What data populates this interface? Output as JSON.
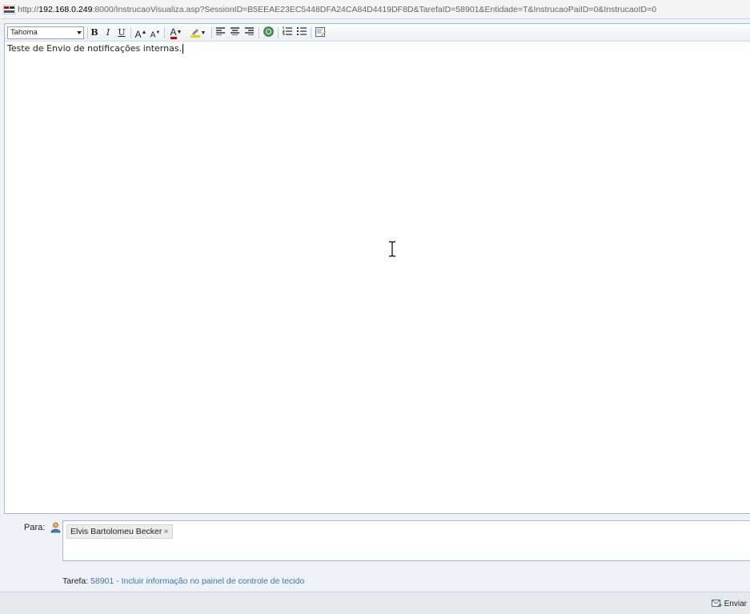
{
  "address_bar": {
    "url_prefix": "http://",
    "url_host": "192.168.0.249",
    "url_rest": ":8000/InstrucaoVisualiza.asp?SessionID=B5EEAE23EC5448DFA24CA84D4419DF8D&TarefaID=58901&Entidade=T&InstrucaoPaiID=0&InstrucaoID=0",
    "page_icon": "site-favicon-icon"
  },
  "toolbar": {
    "font_value": "Tahoma",
    "bold_label": "B",
    "italic_label": "I",
    "underline_label": "U",
    "grow_font_label": "A",
    "shrink_font_label": "A",
    "text_color_label": "A",
    "text_color": "#cc0000",
    "highlight_color": "#f0d000"
  },
  "editor": {
    "content": "Teste de Envio de notificações internas."
  },
  "recipients": {
    "label": "Para:",
    "items": [
      {
        "name": "Elvis Bartolomeu Becker",
        "remove": "×"
      }
    ]
  },
  "task": {
    "label": "Tarefa:",
    "link": "58901 - Incluir informação no painel de controle de tecido"
  },
  "footer": {
    "send_label": "Enviar"
  },
  "colors": {
    "link": "#3a79b8",
    "background": "#eef1f5"
  }
}
